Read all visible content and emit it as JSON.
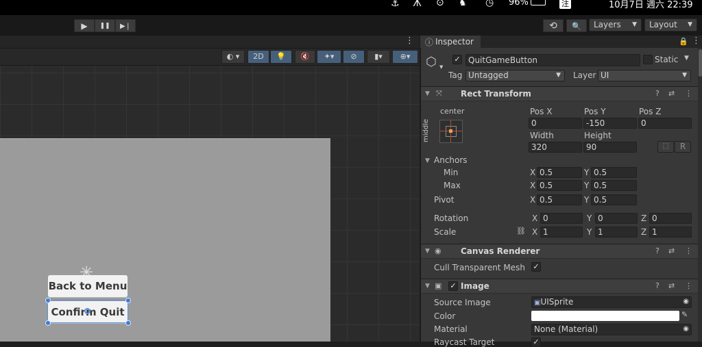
{
  "menubar": {
    "battery": "96%",
    "lang_icon": "注",
    "datetime": "10月7日 週六 22:39"
  },
  "toolbar": {
    "play": "▶",
    "pause": "❚❚",
    "step": "▶❘",
    "history": "⟲",
    "search": "🔍",
    "layers": "Layers",
    "layout": "Layout"
  },
  "scene": {
    "toolbar_2d": "2D",
    "buttons": {
      "back": "Back to Menu",
      "confirm": "Confirm Quit"
    }
  },
  "inspector": {
    "tab": "Inspector",
    "object": {
      "name": "QuitGameButton",
      "static_label": "Static",
      "tag_label": "Tag",
      "tag": "Untagged",
      "layer_label": "Layer",
      "layer": "UI"
    },
    "rect_transform": {
      "title": "Rect Transform",
      "anchor_h": "center",
      "anchor_v": "middle",
      "pos_x_label": "Pos X",
      "pos_y_label": "Pos Y",
      "pos_z_label": "Pos Z",
      "pos_x": "0",
      "pos_y": "-150",
      "pos_z": "0",
      "width_label": "Width",
      "height_label": "Height",
      "width": "320",
      "height": "90",
      "r_button": "R",
      "anchors_label": "Anchors",
      "min_label": "Min",
      "max_label": "Max",
      "min_x": "0.5",
      "min_y": "0.5",
      "max_x": "0.5",
      "max_y": "0.5",
      "pivot_label": "Pivot",
      "pivot_x": "0.5",
      "pivot_y": "0.5",
      "rotation_label": "Rotation",
      "rot_x": "0",
      "rot_y": "0",
      "rot_z": "0",
      "scale_label": "Scale",
      "scale_x": "1",
      "scale_y": "1",
      "scale_z": "1",
      "x": "X",
      "y": "Y",
      "z": "Z"
    },
    "canvas_renderer": {
      "title": "Canvas Renderer",
      "cull_label": "Cull Transparent Mesh"
    },
    "image": {
      "title": "Image",
      "source_label": "Source Image",
      "source": "UISprite",
      "color_label": "Color",
      "color": "#ffffff",
      "material_label": "Material",
      "material": "None (Material)",
      "raycast_label": "Raycast Target"
    }
  }
}
